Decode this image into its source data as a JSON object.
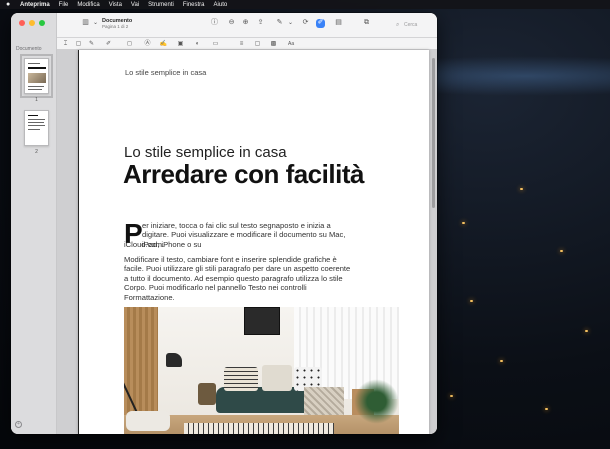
{
  "menubar": {
    "apple": "",
    "items": [
      "Anteprima",
      "File",
      "Modifica",
      "Vista",
      "Vai",
      "Strumenti",
      "Finestra",
      "Aiuto"
    ]
  },
  "sidebar": {
    "title": "Documento",
    "pages": [
      "1",
      "2"
    ]
  },
  "toolbar": {
    "doc_title": "Documento",
    "doc_subtitle": "Pagina 1 di 2",
    "search_placeholder": "Cerca",
    "font_size_label": "Aa"
  },
  "page": {
    "header": "Lo stile semplice in casa",
    "pretitle": "Lo stile semplice in casa",
    "title": "Arredare con facilità",
    "dropcap": "P",
    "para1_first": "er iniziare, tocca o fai clic sul testo segnaposto e inizia a digitare. Puoi visualizzare e modificare il documento su Mac, iPad, iPhone o su",
    "para1_rest": "iCloud.com.",
    "para2": "Modificare il testo, cambiare font e inserire splendide grafiche è facile. Puoi utilizzare gli stili paragrafo per dare un aspetto coerente a tutto il documento. Ad esempio questo paragrafo utilizza lo stile Corpo. Puoi modificarlo nel pannello Testo nei controlli Formattazione."
  },
  "colors": {
    "close": "#ff5f57",
    "minimize": "#febc2e",
    "zoom": "#28c840"
  }
}
